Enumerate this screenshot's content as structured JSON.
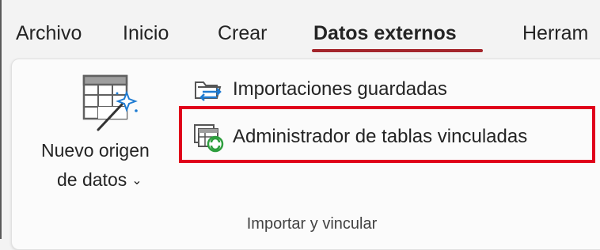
{
  "tabs": [
    {
      "label": "Archivo"
    },
    {
      "label": "Inicio"
    },
    {
      "label": "Crear"
    },
    {
      "label": "Datos externos"
    },
    {
      "label": "Herram"
    }
  ],
  "active_tab": "Datos externos",
  "ribbon": {
    "new_data_source": {
      "line1": "Nuevo origen",
      "line2": "de datos",
      "icon": "table-wand-icon"
    },
    "commands": [
      {
        "label": "Importaciones guardadas",
        "icon": "saved-imports-icon"
      },
      {
        "label": "Administrador de tablas vinculadas",
        "icon": "linked-table-manager-icon"
      }
    ],
    "group_label": "Importar y vincular"
  },
  "colors": {
    "accent": "#a4262c",
    "highlight": "#e0001b"
  }
}
